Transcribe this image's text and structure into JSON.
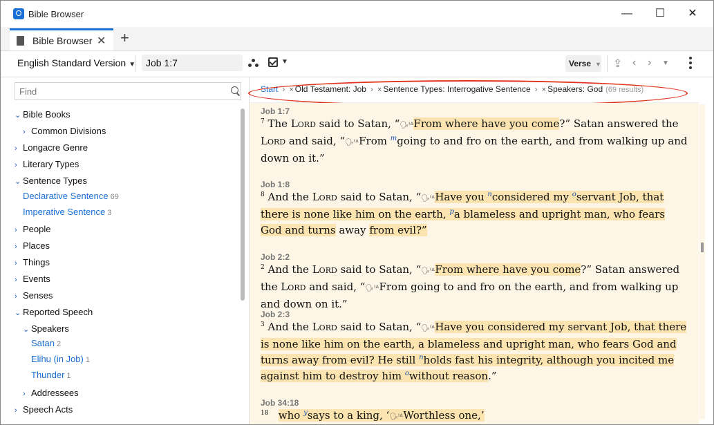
{
  "window": {
    "title": "Bible Browser",
    "minimize": "—",
    "maximize": "☐",
    "close": "✕"
  },
  "tab": {
    "label": "Bible Browser",
    "close": "✕",
    "new_tab": "+"
  },
  "toolbar": {
    "version": "English Standard Version",
    "reference": "Job 1:7",
    "verse_mode": "Verse"
  },
  "sidebar": {
    "find_placeholder": "Find",
    "items": [
      {
        "label": "Bible Books",
        "expanded": true
      },
      {
        "label": "Common Divisions"
      },
      {
        "label": "Longacre Genre"
      },
      {
        "label": "Literary Types"
      },
      {
        "label": "Sentence Types",
        "expanded": true
      },
      {
        "label": "Declarative Sentence",
        "count": "69"
      },
      {
        "label": "Imperative Sentence",
        "count": "3"
      },
      {
        "label": "People"
      },
      {
        "label": "Places"
      },
      {
        "label": "Things"
      },
      {
        "label": "Events"
      },
      {
        "label": "Senses"
      },
      {
        "label": "Reported Speech",
        "expanded": true
      },
      {
        "label": "Speakers",
        "expanded": true
      },
      {
        "label": "Satan",
        "count": "2"
      },
      {
        "label": "Elihu (in Job)",
        "count": "1"
      },
      {
        "label": "Thunder",
        "count": "1"
      },
      {
        "label": "Addressees"
      },
      {
        "label": "Speech Acts"
      }
    ]
  },
  "breadcrumb": {
    "start": "Start",
    "filters": [
      "Old Testament: Job",
      "Sentence Types: Interrogative Sentence",
      "Speakers: God"
    ],
    "results": "(69 results)"
  },
  "results": [
    {
      "ref": "Job 1:7"
    },
    {
      "ref": "Job 1:8"
    },
    {
      "ref": "Job 2:2"
    },
    {
      "ref": "Job 2:3"
    },
    {
      "ref": "Job 34:18"
    }
  ],
  "colors": {
    "accent": "#1a6fd6",
    "highlight": "#fbe4b0",
    "pane": "#fdf6e6",
    "annotation": "#e2321c"
  }
}
